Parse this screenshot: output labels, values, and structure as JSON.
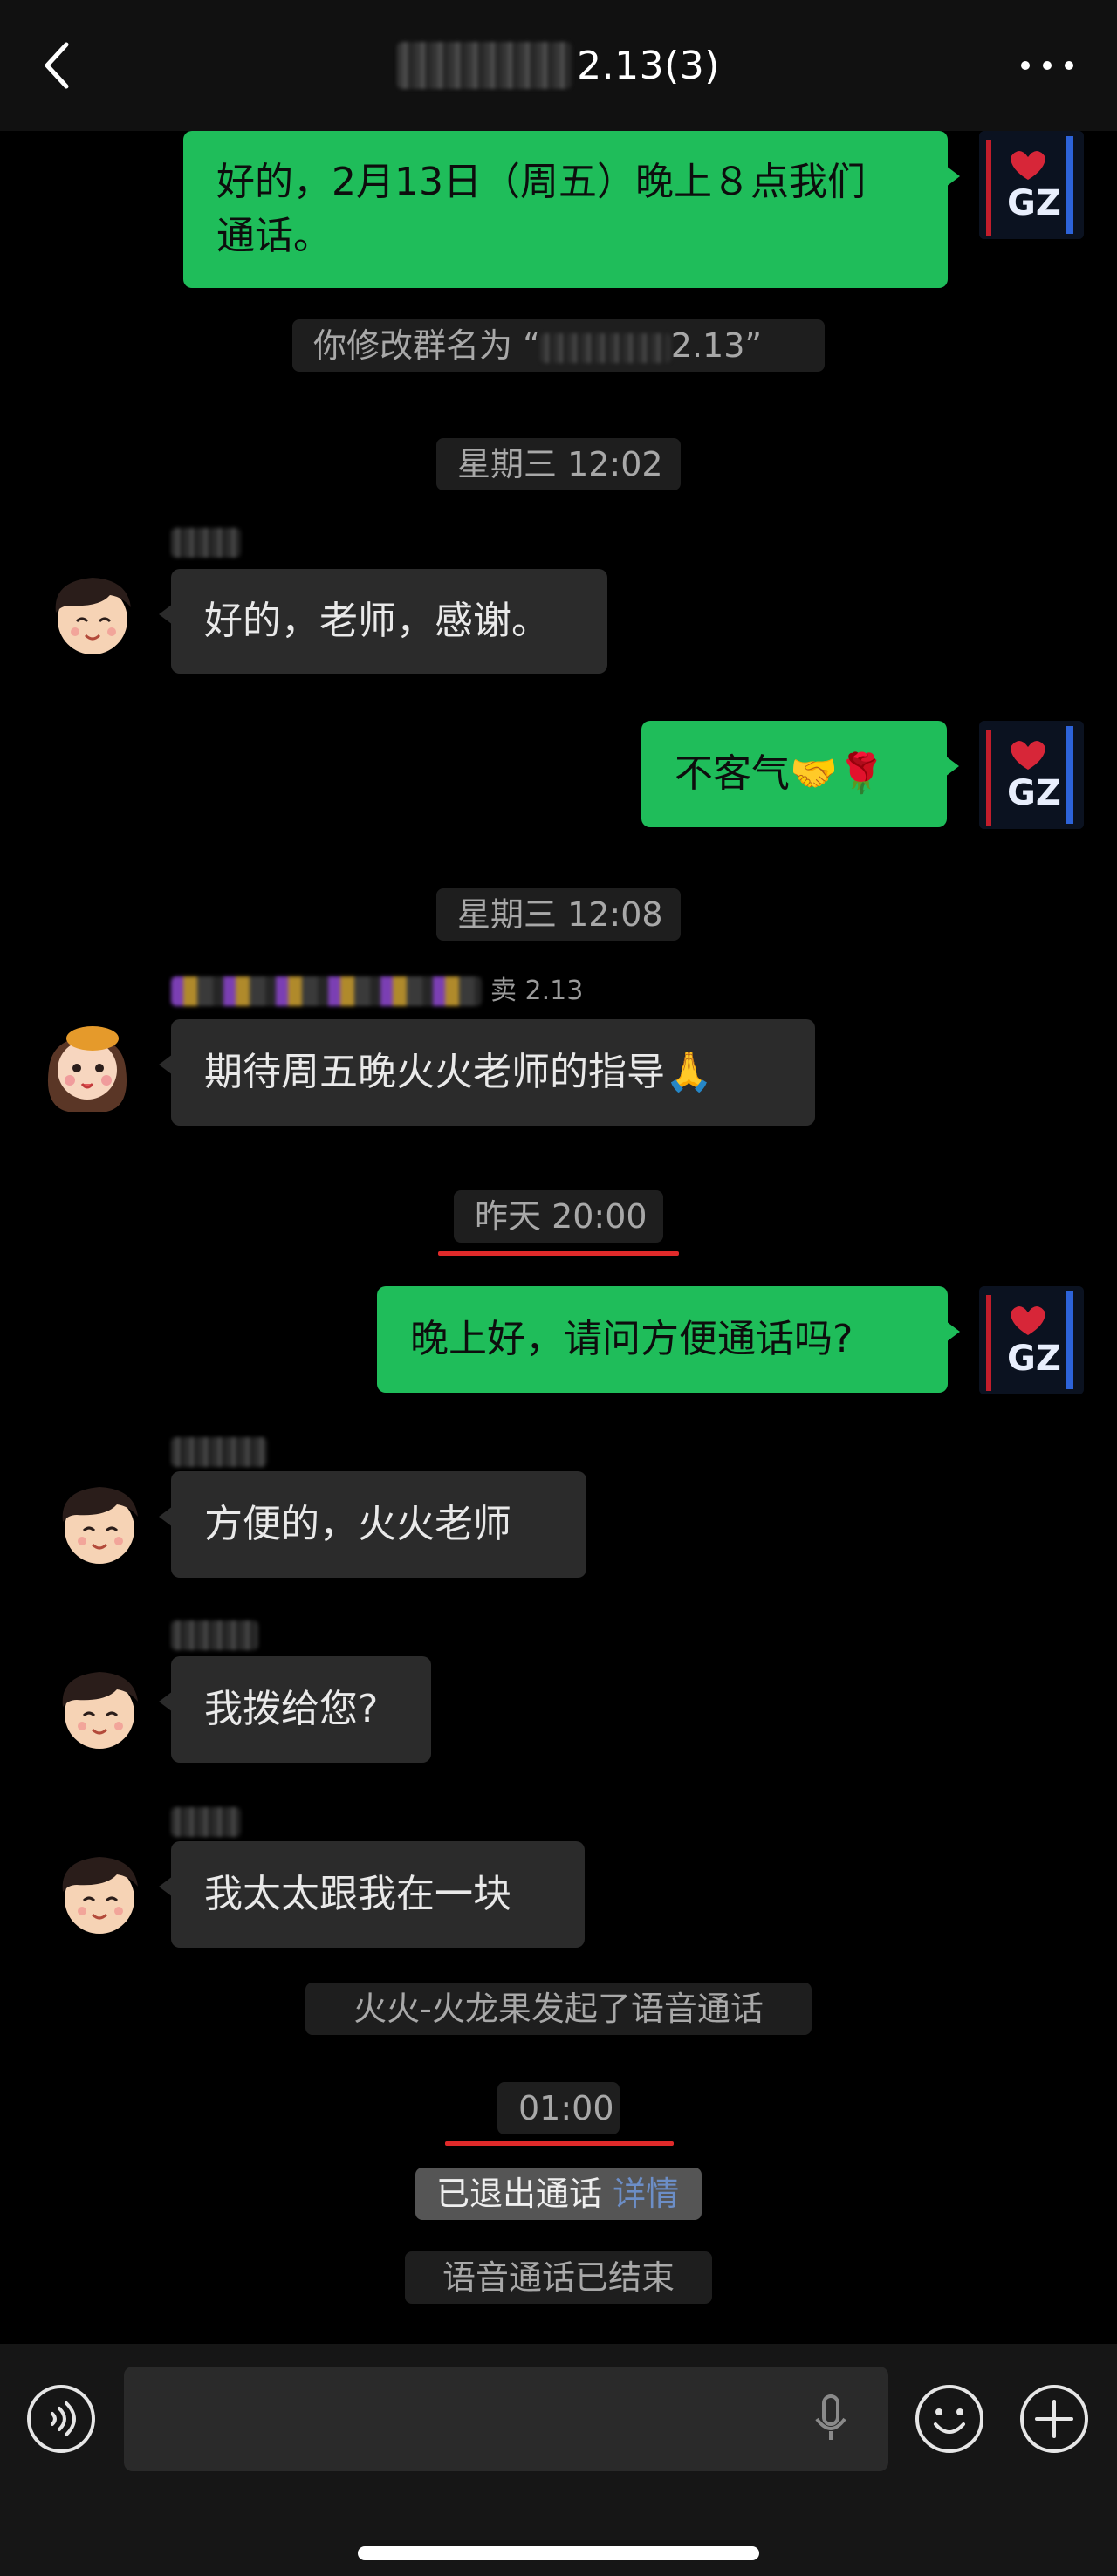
{
  "header": {
    "title": "2.13(3)",
    "back_icon": "chevron-left-icon",
    "more_icon": "more-dots-icon"
  },
  "messages": {
    "m1": "好的，2月13日（周五）晚上８点我们通话。",
    "m1_line1": "好的，2月13日（周五）晚上８点我们",
    "m1_line2": "通话。",
    "sys_rename": "你修改群名为 “",
    "sys_rename_tail": "2.13”",
    "time1": "星期三 12:02",
    "m2": "好的，老师，感谢。",
    "m3": "不客气🤝🌹",
    "time2": "星期三 12:08",
    "sender_m4_suffix": "卖 2.13",
    "m4": "期待周五晚火火老师的指导🙏",
    "time3": "昨天 20:00",
    "m5": "晚上好，请问方便通话吗?",
    "m6": "方便的，火火老师",
    "m7": "我拨给您?",
    "m8": "我太太跟我在一块",
    "sys_call_start": "火火-火龙果发起了语音通话",
    "time4": "01:00",
    "sys_left": "已退出通话",
    "sys_left_link": "详情",
    "sys_call_end": "语音通话已结束"
  },
  "inputbar": {
    "voice_icon": "voice-icon",
    "mic_icon": "microphone-icon",
    "emoji_icon": "emoji-icon",
    "add_icon": "plus-icon"
  },
  "colors": {
    "my_bubble": "#1fbd5a",
    "other_bubble": "#2b2b2b",
    "highlight_underline": "#e02a2a",
    "link": "#6c8ec7"
  }
}
